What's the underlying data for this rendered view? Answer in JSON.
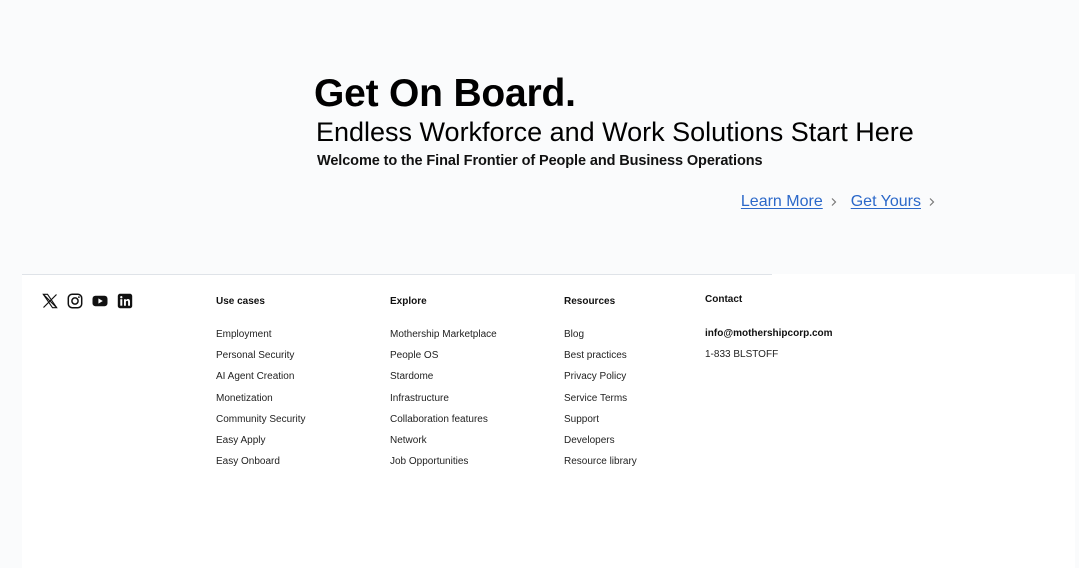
{
  "hero": {
    "title": "Get On Board.",
    "subtitle": "Endless Workforce and Work Solutions Start Here",
    "tagline": "Welcome to the Final Frontier of People and Business Operations",
    "learn_more": "Learn More",
    "get_yours": "Get Yours"
  },
  "colors": {
    "link": "#2b68c9",
    "page_bg": "#fafbfc",
    "footer_bg": "#ffffff"
  },
  "footer": {
    "social": [
      "x-icon",
      "instagram-icon",
      "youtube-icon",
      "linkedin-icon"
    ],
    "use_cases": {
      "heading": "Use cases",
      "items": [
        "Employment",
        "Personal Security",
        "AI Agent Creation",
        "Monetization",
        "Community Security",
        "Easy Apply",
        "Easy Onboard"
      ]
    },
    "explore": {
      "heading": "Explore",
      "items": [
        "Mothership Marketplace",
        "People OS",
        "Stardome",
        "Infrastructure",
        "Collaboration features",
        "Network",
        "Job Opportunities"
      ]
    },
    "resources": {
      "heading": "Resources",
      "items": [
        "Blog",
        "Best practices",
        "Privacy Policy",
        "Service Terms",
        "Support",
        "Developers",
        "Resource library"
      ]
    },
    "contact": {
      "heading": "Contact",
      "email": "info@mothershipcorp.com",
      "phone": "1-833 BLSTOFF"
    }
  }
}
